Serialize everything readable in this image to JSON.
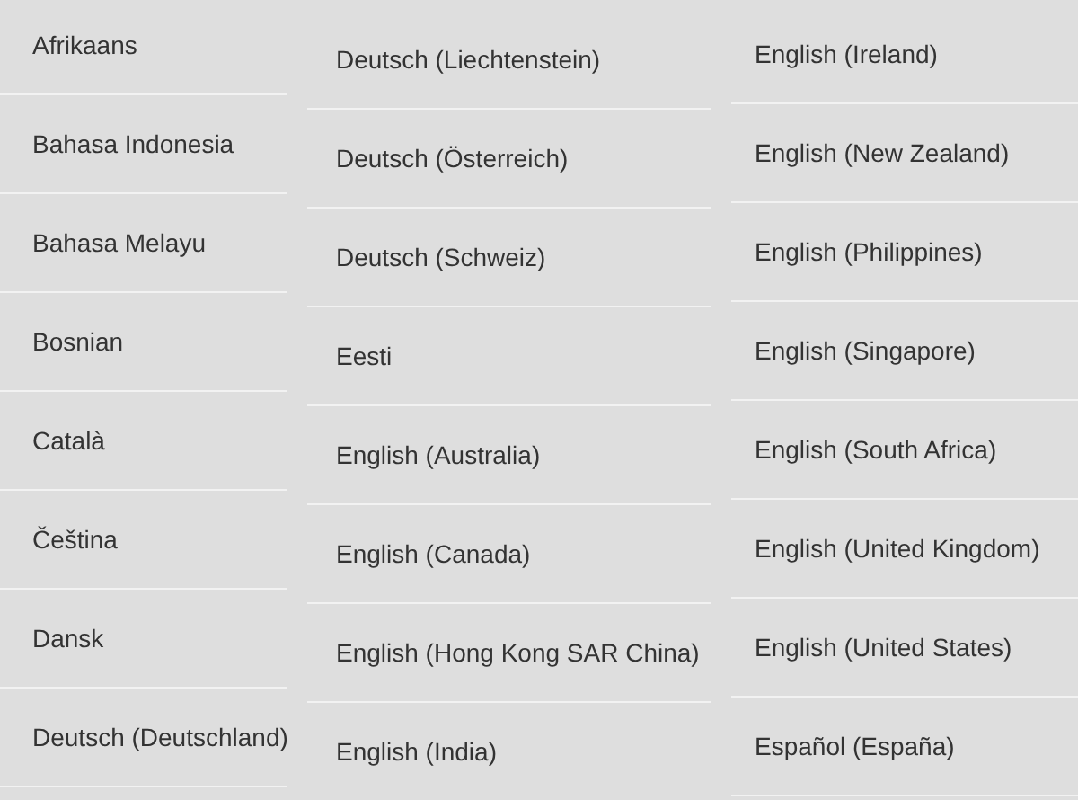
{
  "columns": [
    {
      "items": [
        "Afrikaans",
        "Bahasa Indonesia",
        "Bahasa Melayu",
        "Bosnian",
        "Català",
        "Čeština",
        "Dansk",
        "Deutsch (Deutschland)"
      ]
    },
    {
      "items": [
        "Deutsch (Liechtenstein)",
        "Deutsch (Österreich)",
        "Deutsch (Schweiz)",
        "Eesti",
        "English (Australia)",
        "English (Canada)",
        "English (Hong Kong SAR China)",
        "English (India)"
      ]
    },
    {
      "items": [
        "English (Ireland)",
        "English (New Zealand)",
        "English (Philippines)",
        "English (Singapore)",
        "English (South Africa)",
        "English (United Kingdom)",
        "English (United States)",
        "Español (España)"
      ]
    }
  ]
}
